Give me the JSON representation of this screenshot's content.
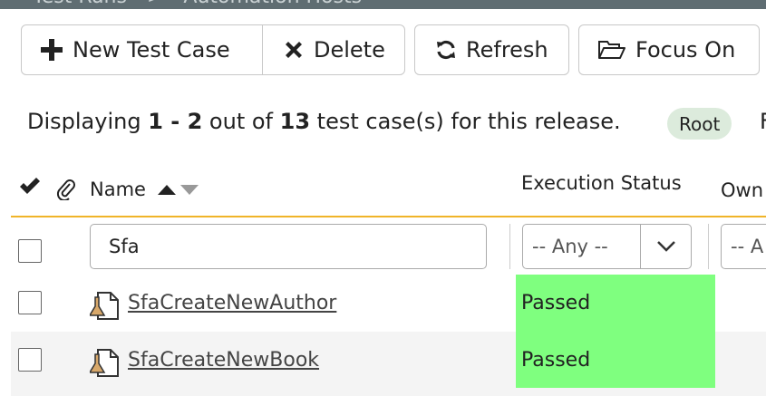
{
  "breadcrumb": {
    "parent": "Test Runs",
    "separator": ">",
    "current": "Automation Hosts"
  },
  "toolbar": {
    "new_test_case_label": "New Test Case",
    "delete_label": "Delete",
    "refresh_label": "Refresh",
    "focus_on_label": "Focus On"
  },
  "summary": {
    "prefix": "Displaying ",
    "range": "1 - 2",
    "middle": " out of ",
    "total": "13",
    "suffix": " test case(s) for this release.",
    "folder_badge": "Root",
    "trailing_cut": "F"
  },
  "table": {
    "columns": {
      "name": "Name",
      "execution_status": "Execution Status",
      "owner": "Own"
    },
    "filters": {
      "name_value": "Sfa",
      "execution_status_value": "-- Any --",
      "owner_value": "-- A"
    },
    "rows": [
      {
        "name": "SfaCreateNewAuthor",
        "execution_status": "Passed"
      },
      {
        "name": "SfaCreateNewBook",
        "execution_status": "Passed"
      }
    ]
  },
  "colors": {
    "passed": "#7fff7f",
    "header_underline": "#f0b429",
    "folder_badge_bg": "#dcebdc",
    "topbar": "#5f6d72"
  }
}
